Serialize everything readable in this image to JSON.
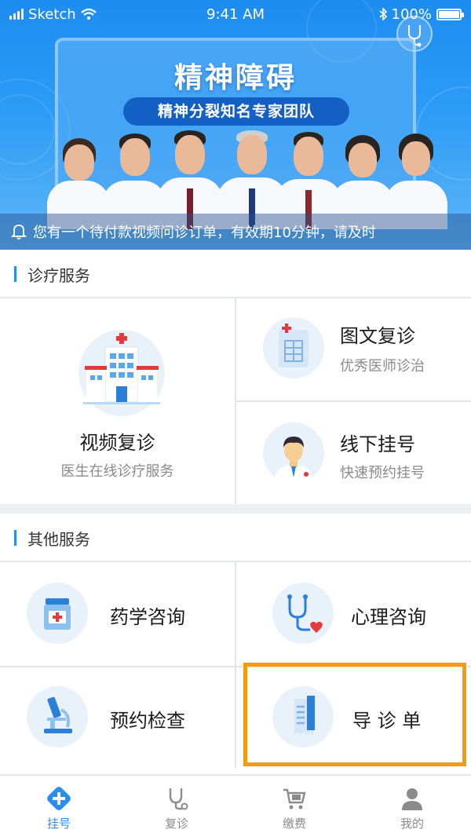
{
  "status_bar": {
    "carrier": "Sketch",
    "time": "9:41 AM",
    "battery": "100%"
  },
  "banner": {
    "title": "精神障碍",
    "subtitle": "精神分裂知名专家团队",
    "notice": "您有一个待付款视频问诊订单，有效期10分钟，请及时"
  },
  "clinic_section": {
    "title": "诊疗服务",
    "video": {
      "title": "视频复诊",
      "subtitle": "医生在线诊疗服务"
    },
    "text_revisit": {
      "title": "图文复诊",
      "subtitle": "优秀医师诊治"
    },
    "offline": {
      "title": "线下挂号",
      "subtitle": "快速预约挂号"
    }
  },
  "other_section": {
    "title": "其他服务",
    "items": [
      {
        "label": "药学咨询",
        "icon": "medicine-box-icon"
      },
      {
        "label": "心理咨询",
        "icon": "stethoscope-heart-icon"
      },
      {
        "label": "预约检查",
        "icon": "microscope-icon"
      },
      {
        "label": "导 诊 单",
        "icon": "receipt-icon"
      }
    ]
  },
  "tabbar": {
    "items": [
      {
        "label": "挂号",
        "icon": "plus-diamond-icon",
        "active": true
      },
      {
        "label": "复诊",
        "icon": "stethoscope-icon",
        "active": false
      },
      {
        "label": "缴费",
        "icon": "cart-icon",
        "active": false
      },
      {
        "label": "我的",
        "icon": "person-icon",
        "active": false
      }
    ]
  },
  "colors": {
    "accent": "#2a8ef0",
    "highlight": "#f39a13",
    "banner_blue": "#1c8cf0"
  }
}
